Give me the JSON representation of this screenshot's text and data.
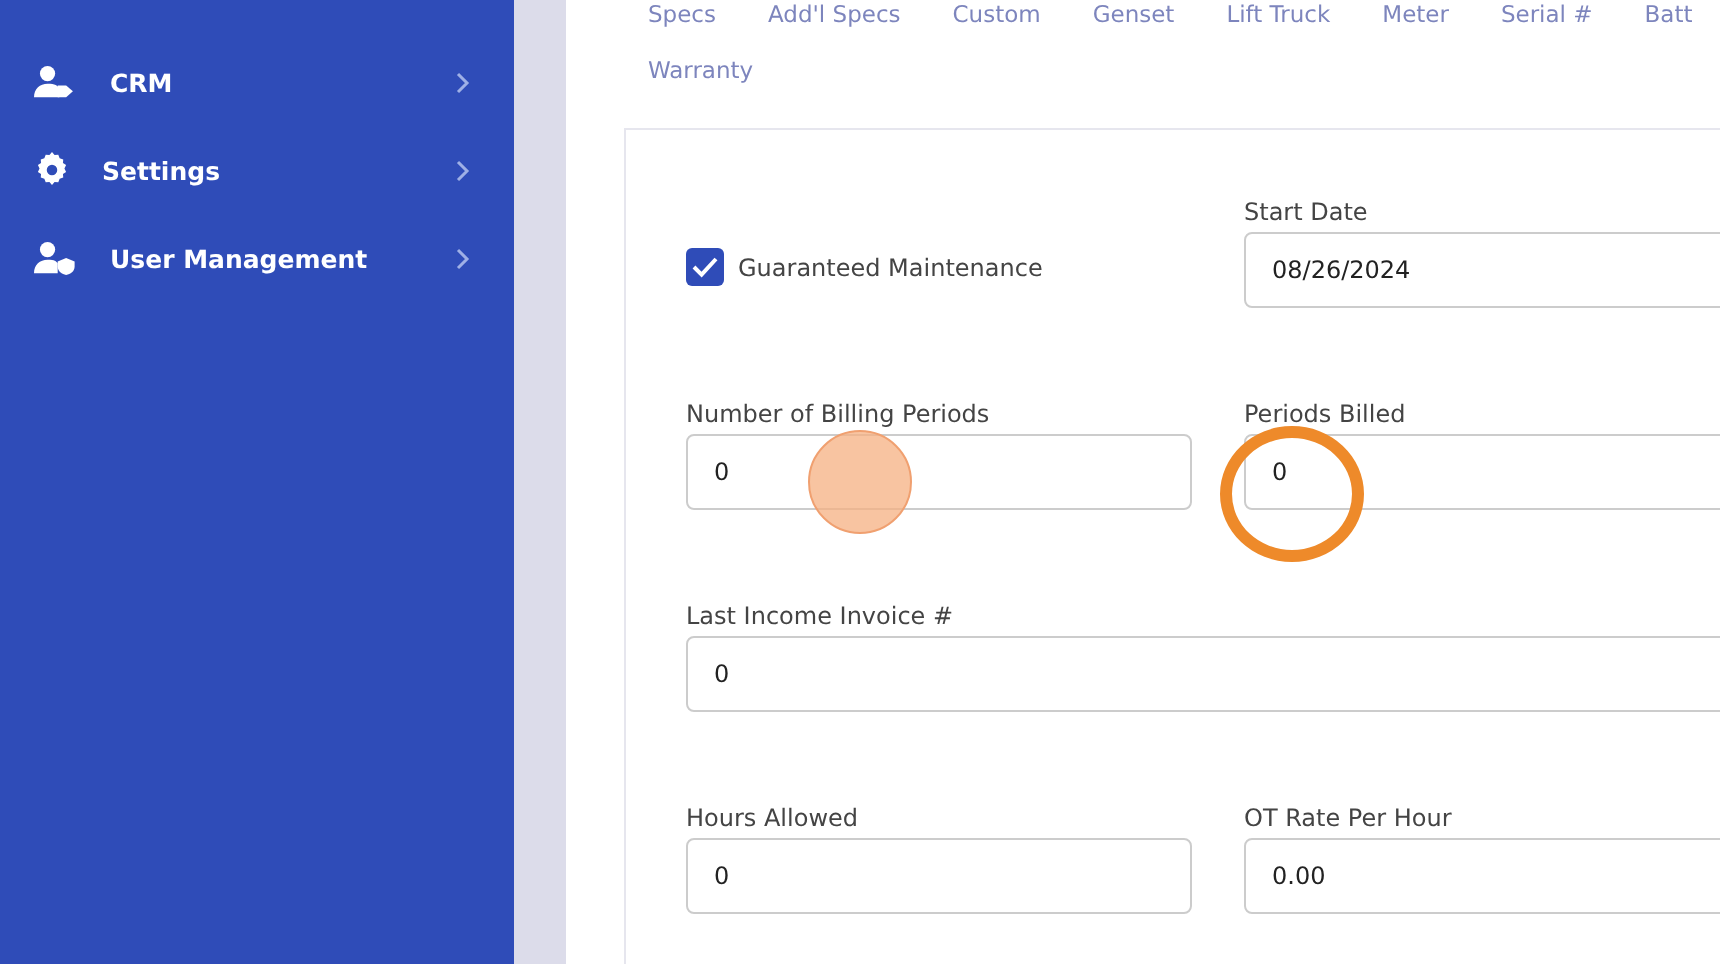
{
  "sidebar": {
    "items": [
      {
        "label": "CRM"
      },
      {
        "label": "Settings"
      },
      {
        "label": "User Management"
      }
    ]
  },
  "tabs": [
    {
      "label": "Specs"
    },
    {
      "label": "Add'l Specs"
    },
    {
      "label": "Custom"
    },
    {
      "label": "Genset"
    },
    {
      "label": "Lift Truck"
    },
    {
      "label": "Meter"
    },
    {
      "label": "Serial #"
    },
    {
      "label": "Batt"
    },
    {
      "label": "Warranty"
    }
  ],
  "form": {
    "guaranteed_maintenance": {
      "label": "Guaranteed Maintenance",
      "checked": true
    },
    "start_date": {
      "label": "Start Date",
      "value": "08/26/2024"
    },
    "billing_periods": {
      "label": "Number of Billing Periods",
      "value": "0"
    },
    "periods_billed": {
      "label": "Periods Billed",
      "value": "0"
    },
    "last_invoice": {
      "label": "Last Income Invoice #",
      "value": "0"
    },
    "hours_allowed": {
      "label": "Hours Allowed",
      "value": "0"
    },
    "ot_rate": {
      "label": "OT Rate Per Hour",
      "value": "0.00"
    }
  }
}
